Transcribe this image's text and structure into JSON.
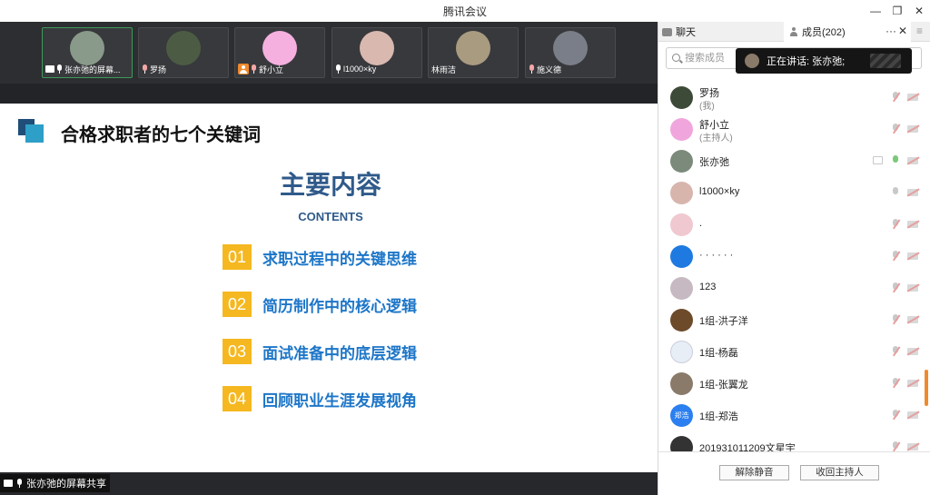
{
  "window": {
    "title": "腾讯会议"
  },
  "tiles": [
    {
      "name": "张亦弛的屏幕...",
      "color": "#8a9a8a"
    },
    {
      "name": "罗扬",
      "color": "#4c5c44"
    },
    {
      "name": "舒小立",
      "color": "#f5b0e0"
    },
    {
      "name": "l1000×ky",
      "color": "#d9b8b0"
    },
    {
      "name": "林雨洁",
      "color": "#a89b80"
    },
    {
      "name": "施义德",
      "color": "#7a7e88"
    }
  ],
  "slide": {
    "heading": "合格求职者的七个关键词",
    "main_title": "主要内容",
    "subtitle": "CONTENTS",
    "items": [
      {
        "num": "01",
        "text": "求职过程中的关键思维"
      },
      {
        "num": "02",
        "text": "简历制作中的核心逻辑"
      },
      {
        "num": "03",
        "text": "面试准备中的底层逻辑"
      },
      {
        "num": "04",
        "text": "回顾职业生涯发展视角"
      }
    ]
  },
  "share_label": "张亦弛的屏幕共享",
  "panel": {
    "tab_chat": "聊天",
    "tab_members": "成员(202)",
    "more": "···",
    "close": "✕",
    "menu": "≡",
    "search_placeholder": "搜索成员",
    "speaking": "正在讲话: 张亦弛;",
    "members": [
      {
        "name": "罗扬",
        "role": "(我)",
        "color": "#3d4a37"
      },
      {
        "name": "舒小立",
        "role": "(主持人)",
        "color": "#f0a6dc"
      },
      {
        "name": "张亦弛",
        "color": "#7b8a7b"
      },
      {
        "name": "l1000×ky",
        "color": "#d7b5ad"
      },
      {
        "name": ".",
        "color": "#f0c8d0"
      },
      {
        "name": "· · · · · ·",
        "color": "#1e7ae0"
      },
      {
        "name": "123",
        "color": "#c7b9c2"
      },
      {
        "name": "1组-洪子洋",
        "color": "#6c4a2a"
      },
      {
        "name": "1组-杨磊",
        "color": "#e7eef5"
      },
      {
        "name": "1组-张翼龙",
        "color": "#8a7a6a"
      },
      {
        "name": "1组-郑浩",
        "avatar_text": "郑浩",
        "color": "#2b7ff0"
      },
      {
        "name": "201931011209文星宇",
        "color": "#333333"
      }
    ],
    "btn_unmute": "解除静音",
    "btn_revoke_host": "收回主持人"
  }
}
